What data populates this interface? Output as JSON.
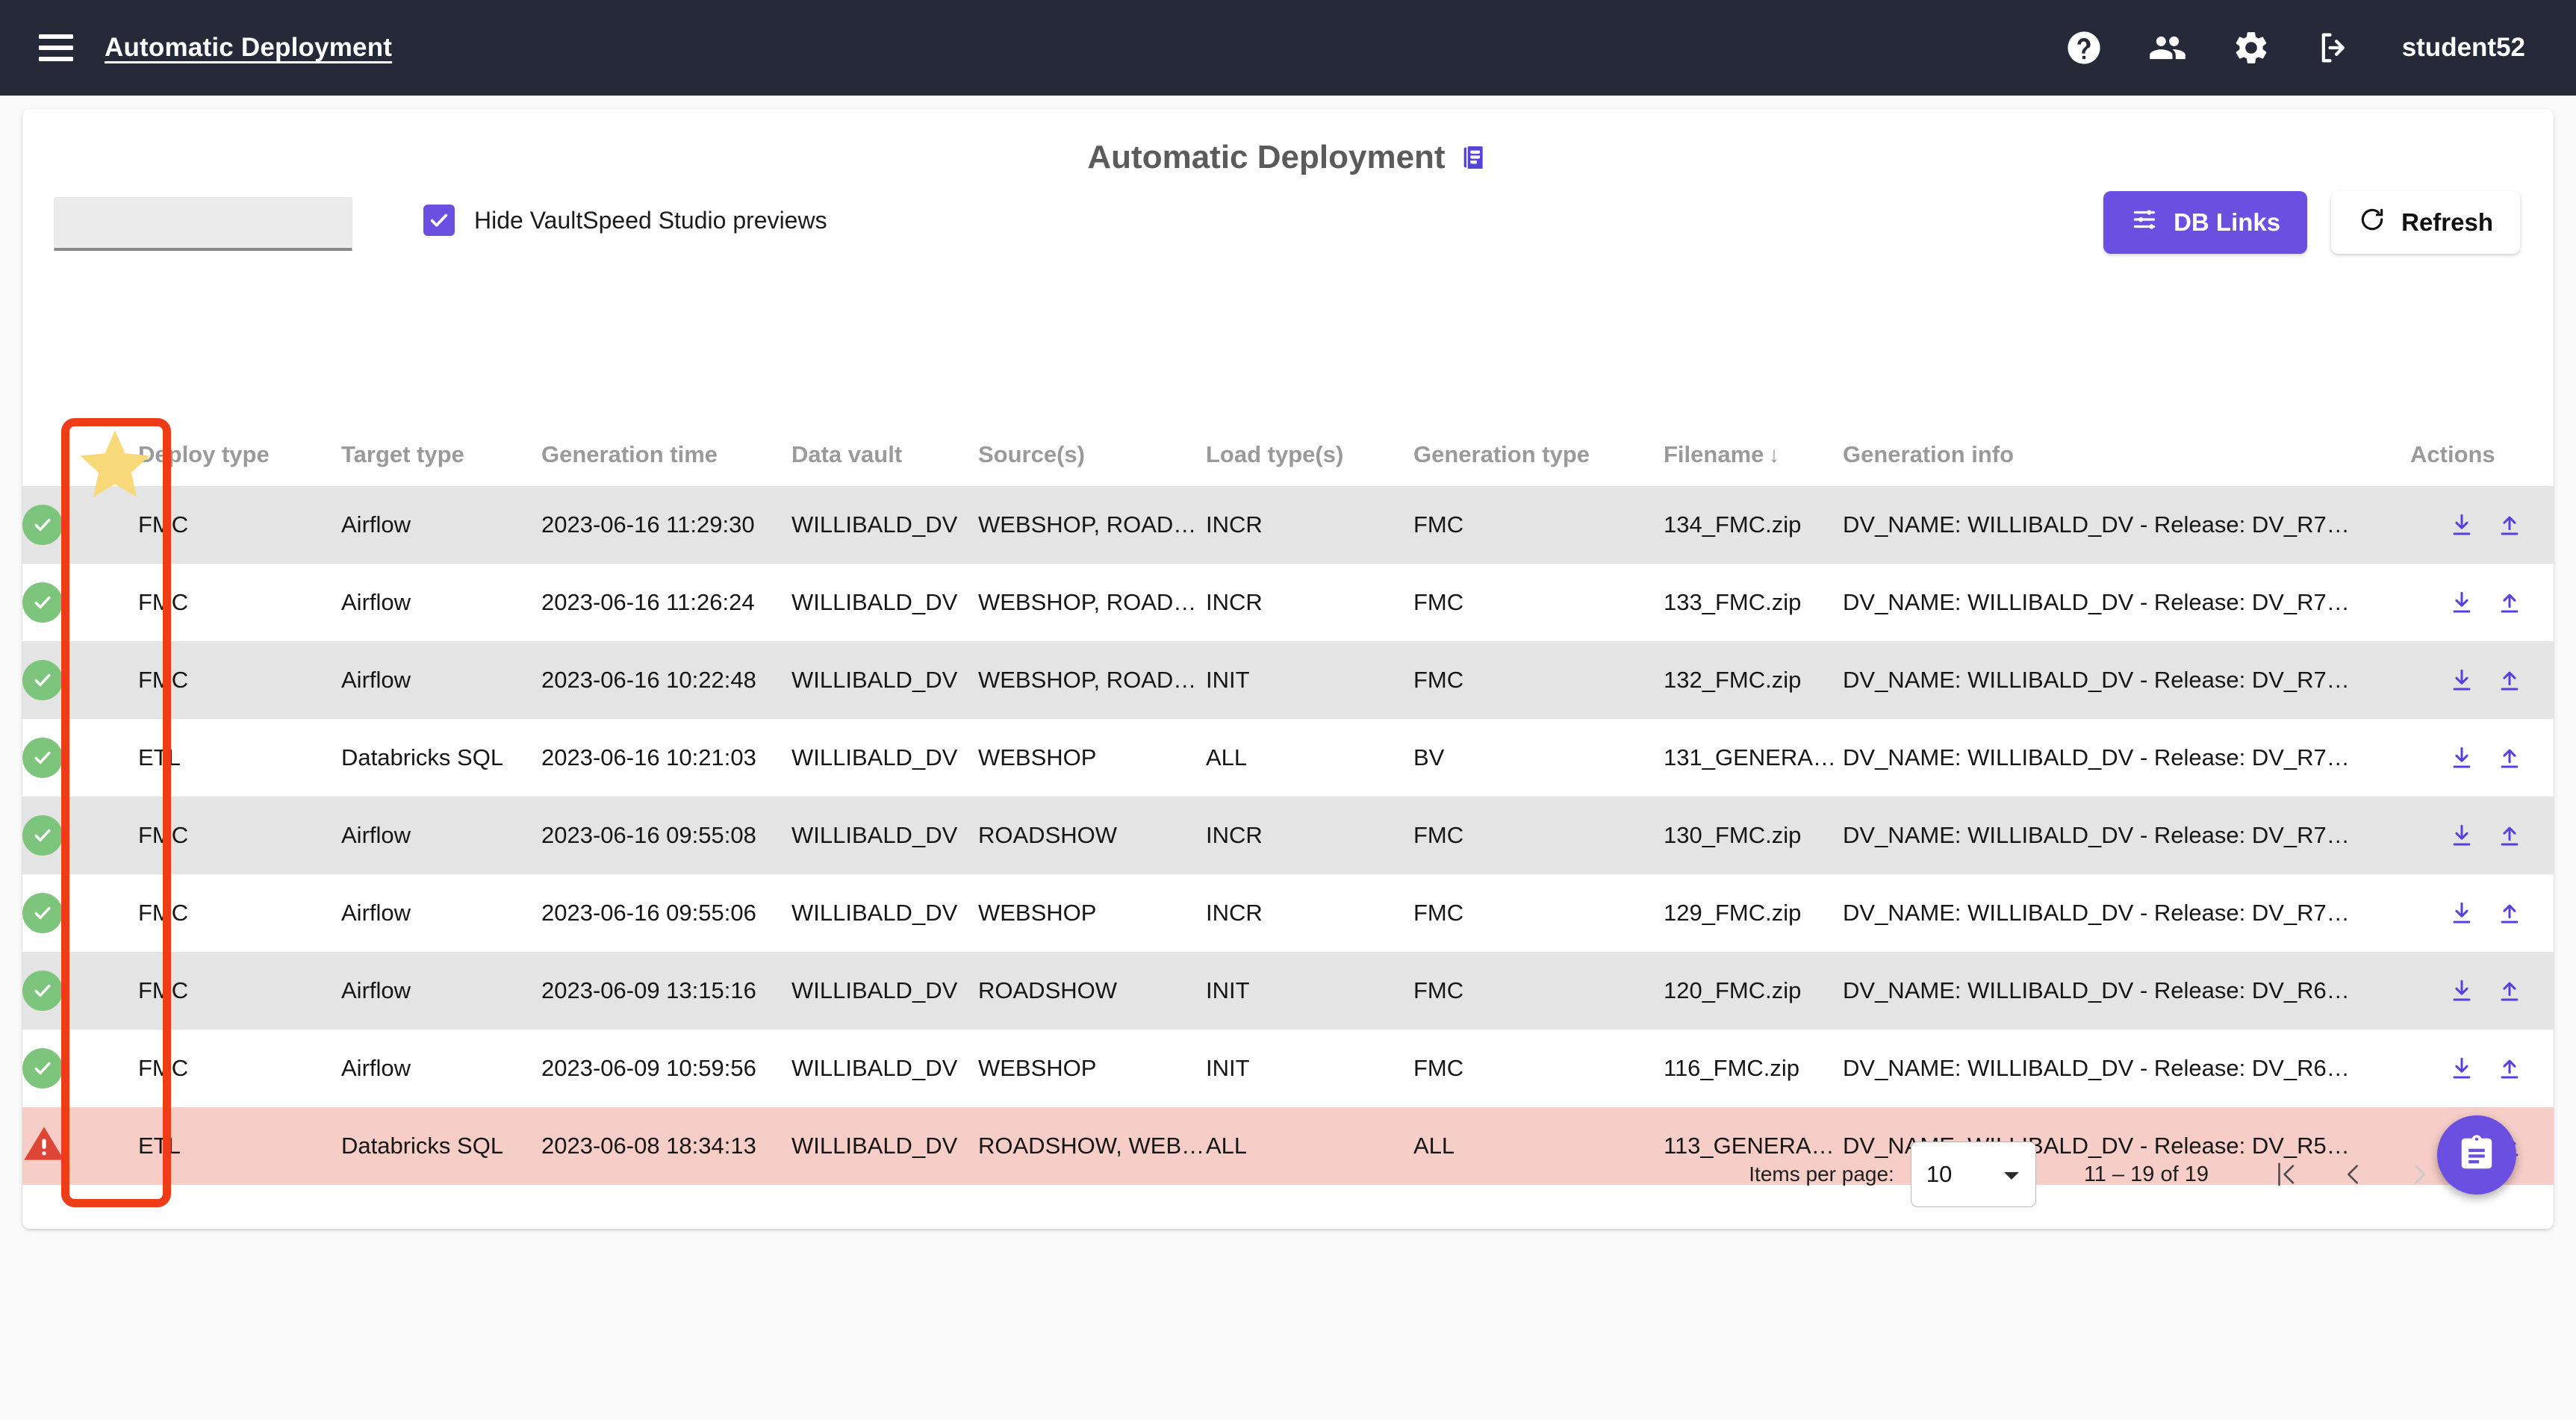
{
  "topbar": {
    "title": "Automatic Deployment",
    "menu_icon": "hamburger-icon",
    "help_icon": "help-icon",
    "people_icon": "people-icon",
    "settings_icon": "gear-icon",
    "logout_icon": "logout-icon",
    "user": "student52"
  },
  "page": {
    "title": "Automatic Deployment",
    "title_icon": "document-list-icon"
  },
  "controls": {
    "filter_value": "",
    "filter_placeholder": "",
    "checkbox_label": "Hide VaultSpeed Studio previews",
    "checkbox_checked": true,
    "db_links_label": "DB Links",
    "db_links_icon": "tune-icon",
    "refresh_label": "Refresh",
    "refresh_icon": "refresh-icon"
  },
  "table": {
    "headers": {
      "status": "",
      "deploy_type": "Deploy type",
      "target_type": "Target type",
      "generation_time": "Generation time",
      "data_vault": "Data vault",
      "sources": "Source(s)",
      "load_types": "Load type(s)",
      "generation_type": "Generation type",
      "filename": "Filename",
      "filename_sort": "↓",
      "generation_info": "Generation info",
      "actions": "Actions"
    },
    "rows": [
      {
        "status": "success",
        "deploy_type": "FMC",
        "target_type": "Airflow",
        "generation_time": "2023-06-16 11:29:30",
        "data_vault": "WILLIBALD_DV",
        "sources": "WEBSHOP, ROADS…",
        "load_types": "INCR",
        "generation_type": "FMC",
        "filename": "134_FMC.zip",
        "generation_info": "DV_NAME: WILLIBALD_DV - Release: DV_R7…"
      },
      {
        "status": "success",
        "deploy_type": "FMC",
        "target_type": "Airflow",
        "generation_time": "2023-06-16 11:26:24",
        "data_vault": "WILLIBALD_DV",
        "sources": "WEBSHOP, ROADS…",
        "load_types": "INCR",
        "generation_type": "FMC",
        "filename": "133_FMC.zip",
        "generation_info": "DV_NAME: WILLIBALD_DV - Release: DV_R7…"
      },
      {
        "status": "success",
        "deploy_type": "FMC",
        "target_type": "Airflow",
        "generation_time": "2023-06-16 10:22:48",
        "data_vault": "WILLIBALD_DV",
        "sources": "WEBSHOP, ROADS…",
        "load_types": "INIT",
        "generation_type": "FMC",
        "filename": "132_FMC.zip",
        "generation_info": "DV_NAME: WILLIBALD_DV - Release: DV_R7…"
      },
      {
        "status": "success",
        "deploy_type": "ETL",
        "target_type": "Databricks SQL",
        "generation_time": "2023-06-16 10:21:03",
        "data_vault": "WILLIBALD_DV",
        "sources": "WEBSHOP",
        "load_types": "ALL",
        "generation_type": "BV",
        "filename": "131_GENERA…",
        "generation_info": "DV_NAME: WILLIBALD_DV - Release: DV_R7…"
      },
      {
        "status": "success",
        "deploy_type": "FMC",
        "target_type": "Airflow",
        "generation_time": "2023-06-16 09:55:08",
        "data_vault": "WILLIBALD_DV",
        "sources": "ROADSHOW",
        "load_types": "INCR",
        "generation_type": "FMC",
        "filename": "130_FMC.zip",
        "generation_info": "DV_NAME: WILLIBALD_DV - Release: DV_R7…"
      },
      {
        "status": "success",
        "deploy_type": "FMC",
        "target_type": "Airflow",
        "generation_time": "2023-06-16 09:55:06",
        "data_vault": "WILLIBALD_DV",
        "sources": "WEBSHOP",
        "load_types": "INCR",
        "generation_type": "FMC",
        "filename": "129_FMC.zip",
        "generation_info": "DV_NAME: WILLIBALD_DV - Release: DV_R7…"
      },
      {
        "status": "success",
        "deploy_type": "FMC",
        "target_type": "Airflow",
        "generation_time": "2023-06-09 13:15:16",
        "data_vault": "WILLIBALD_DV",
        "sources": "ROADSHOW",
        "load_types": "INIT",
        "generation_type": "FMC",
        "filename": "120_FMC.zip",
        "generation_info": "DV_NAME: WILLIBALD_DV - Release: DV_R6…"
      },
      {
        "status": "success",
        "deploy_type": "FMC",
        "target_type": "Airflow",
        "generation_time": "2023-06-09 10:59:56",
        "data_vault": "WILLIBALD_DV",
        "sources": "WEBSHOP",
        "load_types": "INIT",
        "generation_type": "FMC",
        "filename": "116_FMC.zip",
        "generation_info": "DV_NAME: WILLIBALD_DV - Release: DV_R6…"
      },
      {
        "status": "error",
        "deploy_type": "ETL",
        "target_type": "Databricks SQL",
        "generation_time": "2023-06-08 18:34:13",
        "data_vault": "WILLIBALD_DV",
        "sources": "ROADSHOW, WEB…",
        "load_types": "ALL",
        "generation_type": "ALL",
        "filename": "113_GENERA…",
        "generation_info": "DV_NAME: WILLIBALD_DV - Release: DV_R5…"
      }
    ],
    "row_action_icons": {
      "download": "download-icon",
      "upload": "upload-icon"
    }
  },
  "paginator": {
    "items_per_page_label": "Items per page:",
    "items_per_page_value": "10",
    "range_label": "11 – 19 of 19",
    "first_page_icon": "first-page-icon",
    "prev_page_icon": "prev-page-icon",
    "next_page_icon": "next-page-icon",
    "last_page_icon": "last-page-icon",
    "next_disabled": true,
    "last_disabled": true
  },
  "fab": {
    "icon": "clipboard-icon"
  },
  "annotation": {
    "highlight_icon": "star-icon",
    "box_color": "#ee3b18",
    "star_color": "#f7d97a"
  },
  "colors": {
    "topbar_bg": "#262938",
    "accent": "#6a4fe0",
    "success": "#7dc47d",
    "error": "#e0463a",
    "error_row_bg": "#f6cdc7"
  }
}
